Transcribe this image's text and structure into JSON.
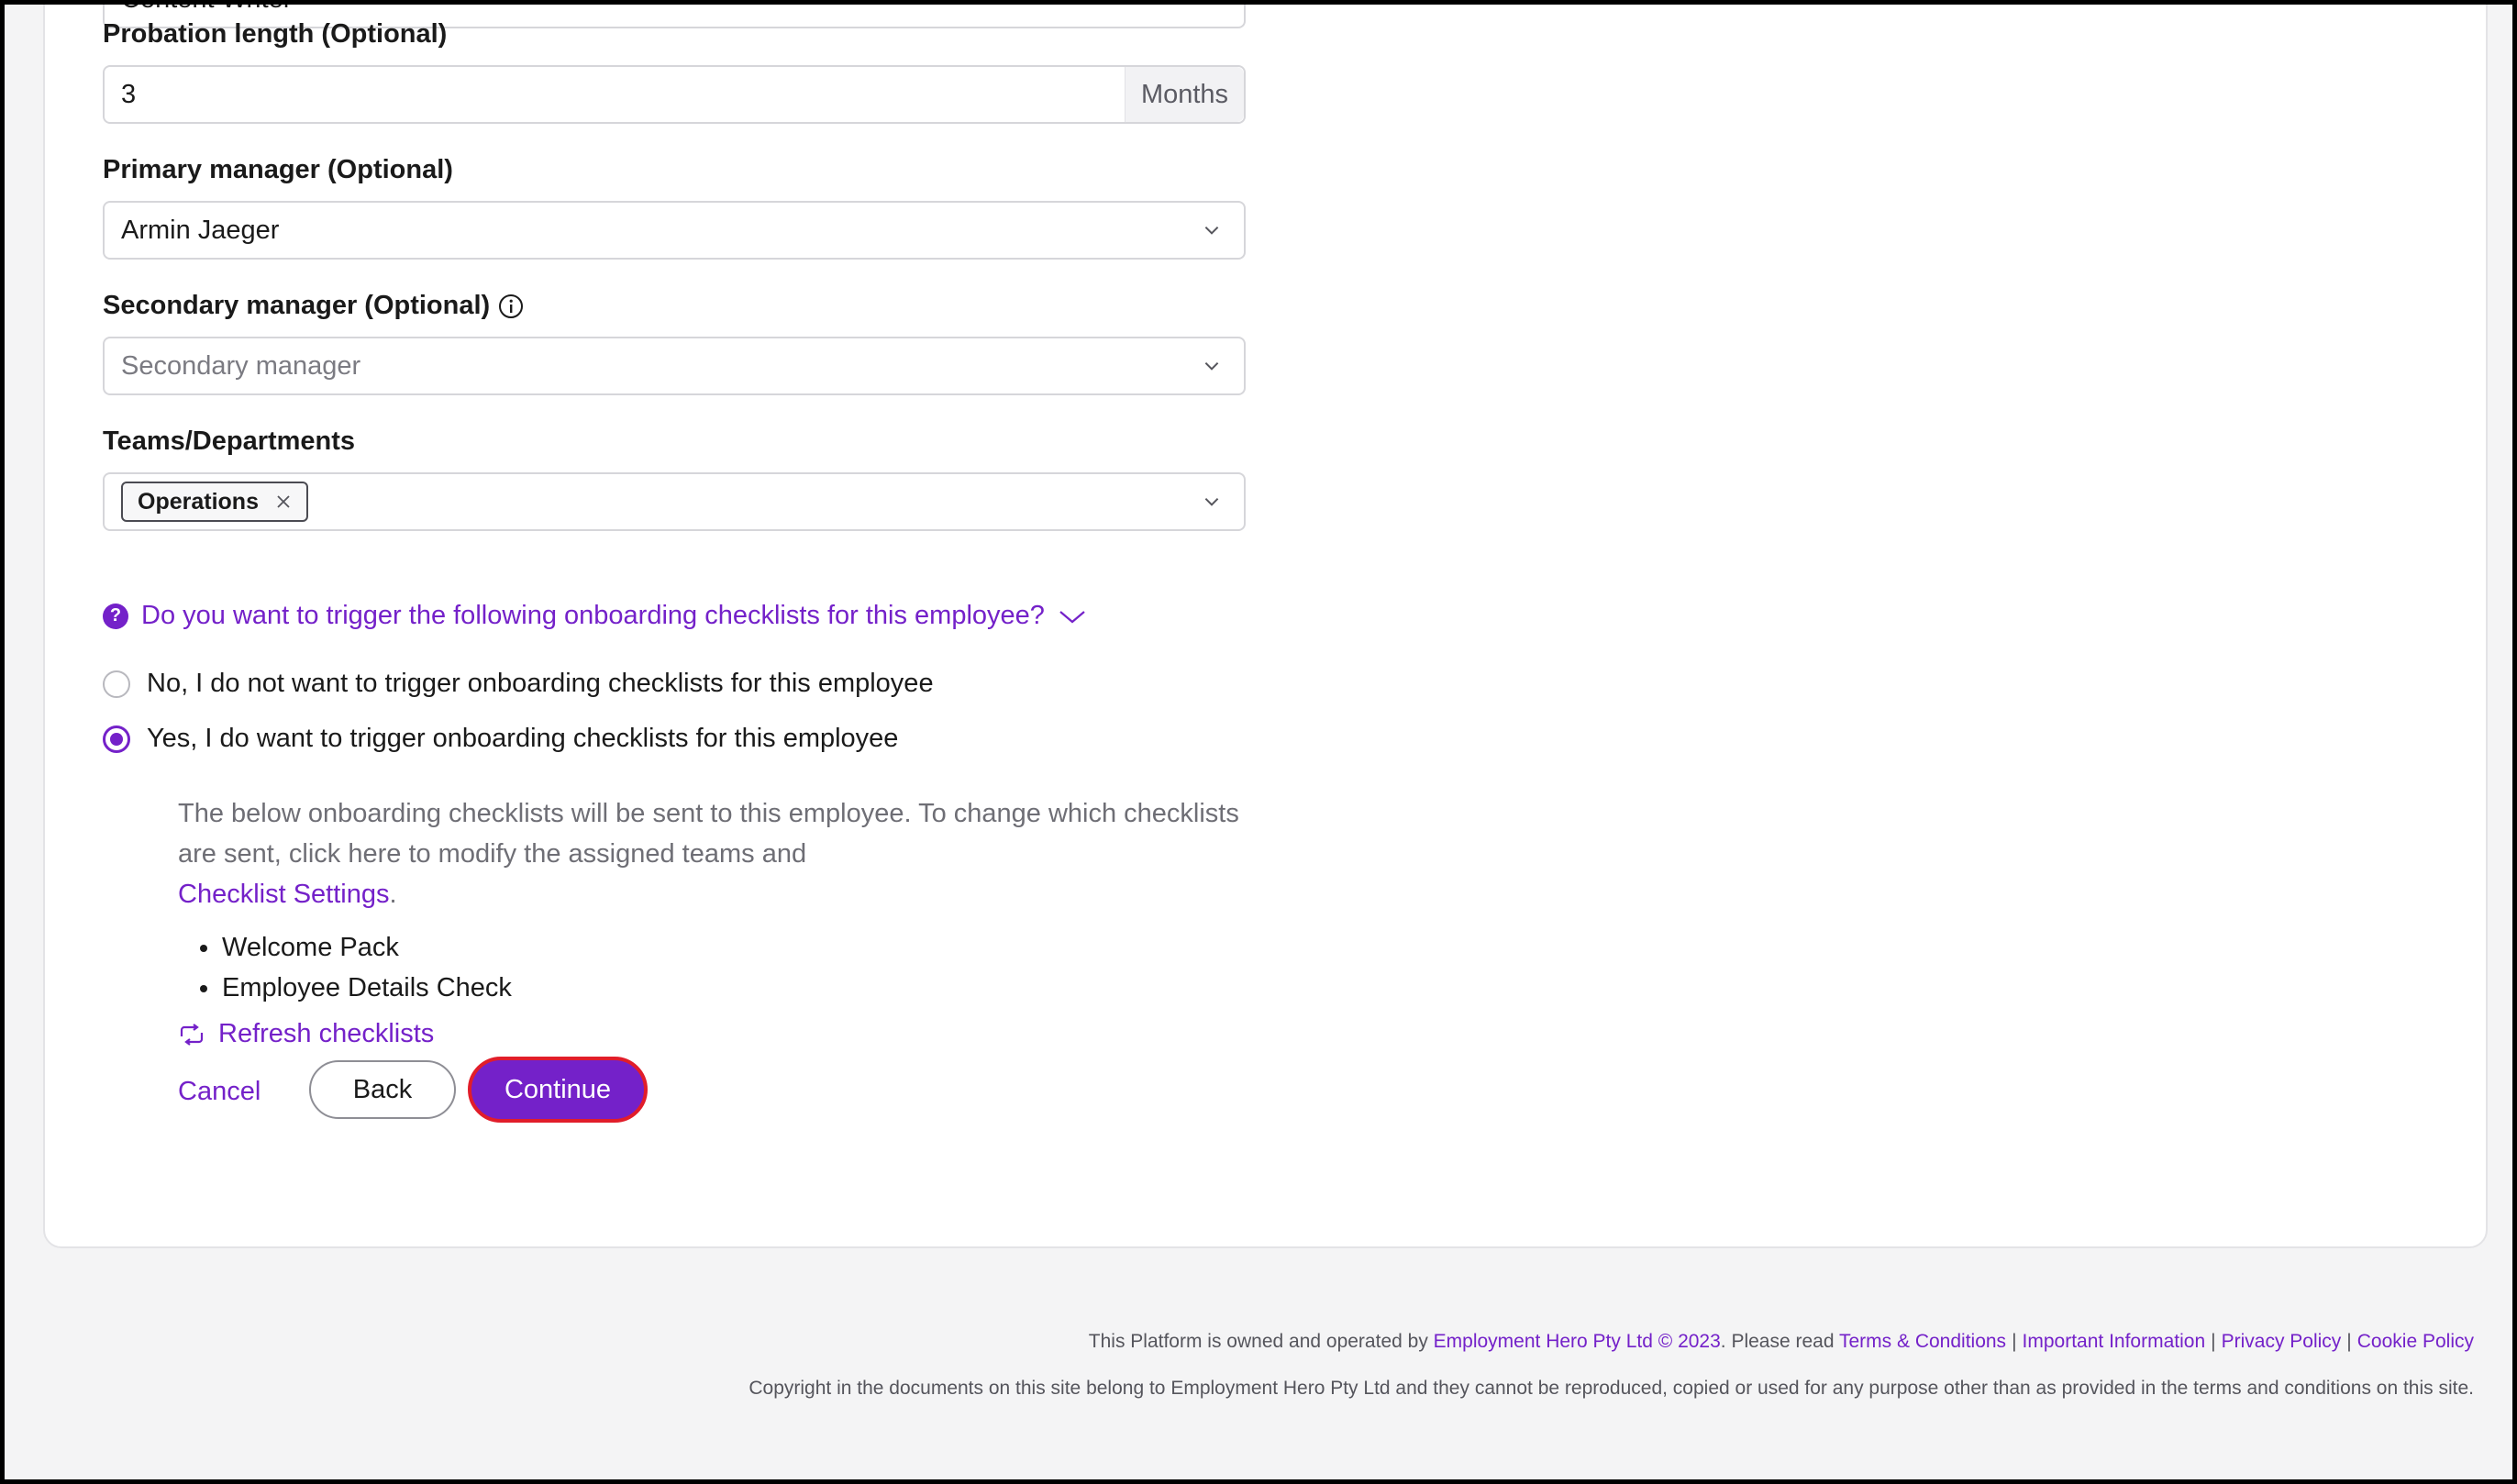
{
  "fields": {
    "job_title": {
      "value": "Content Writer"
    },
    "probation": {
      "label": "Probation length (Optional)",
      "value": "3",
      "suffix": "Months"
    },
    "primary_manager": {
      "label": "Primary manager (Optional)",
      "value": "Armin Jaeger"
    },
    "secondary_manager": {
      "label": "Secondary manager (Optional)",
      "placeholder": "Secondary manager"
    },
    "teams": {
      "label": "Teams/Departments",
      "tags": [
        "Operations"
      ]
    }
  },
  "onboarding": {
    "question": "Do you want to trigger the following onboarding checklists for this employee?",
    "option_no": "No, I do not want to trigger onboarding checklists for this employee",
    "option_yes": "Yes, I do want to trigger onboarding checklists for this employee",
    "selected": "yes",
    "explain_text": "The below onboarding checklists will be sent to this employee. To change which checklists are sent, click here to modify the assigned teams and ",
    "settings_link": "Checklist Settings",
    "settings_link_suffix": ".",
    "checklists": [
      "Welcome Pack",
      "Employee Details Check"
    ],
    "refresh_label": "Refresh checklists"
  },
  "actions": {
    "cancel": "Cancel",
    "back": "Back",
    "continue": "Continue"
  },
  "footer": {
    "prefix": "This Platform is owned and operated by ",
    "company_link": "Employment Hero Pty Ltd © 2023",
    "read_text": ". Please read ",
    "links": [
      "Terms & Conditions",
      "Important Information",
      "Privacy Policy",
      "Cookie Policy"
    ],
    "copyright": "Copyright in the documents on this site belong to Employment Hero Pty Ltd and they cannot be reproduced, copied or used for any purpose other than as provided in the terms and conditions on this site."
  },
  "colors": {
    "accent": "#7421c9",
    "focus_ring": "#e11d2a"
  }
}
